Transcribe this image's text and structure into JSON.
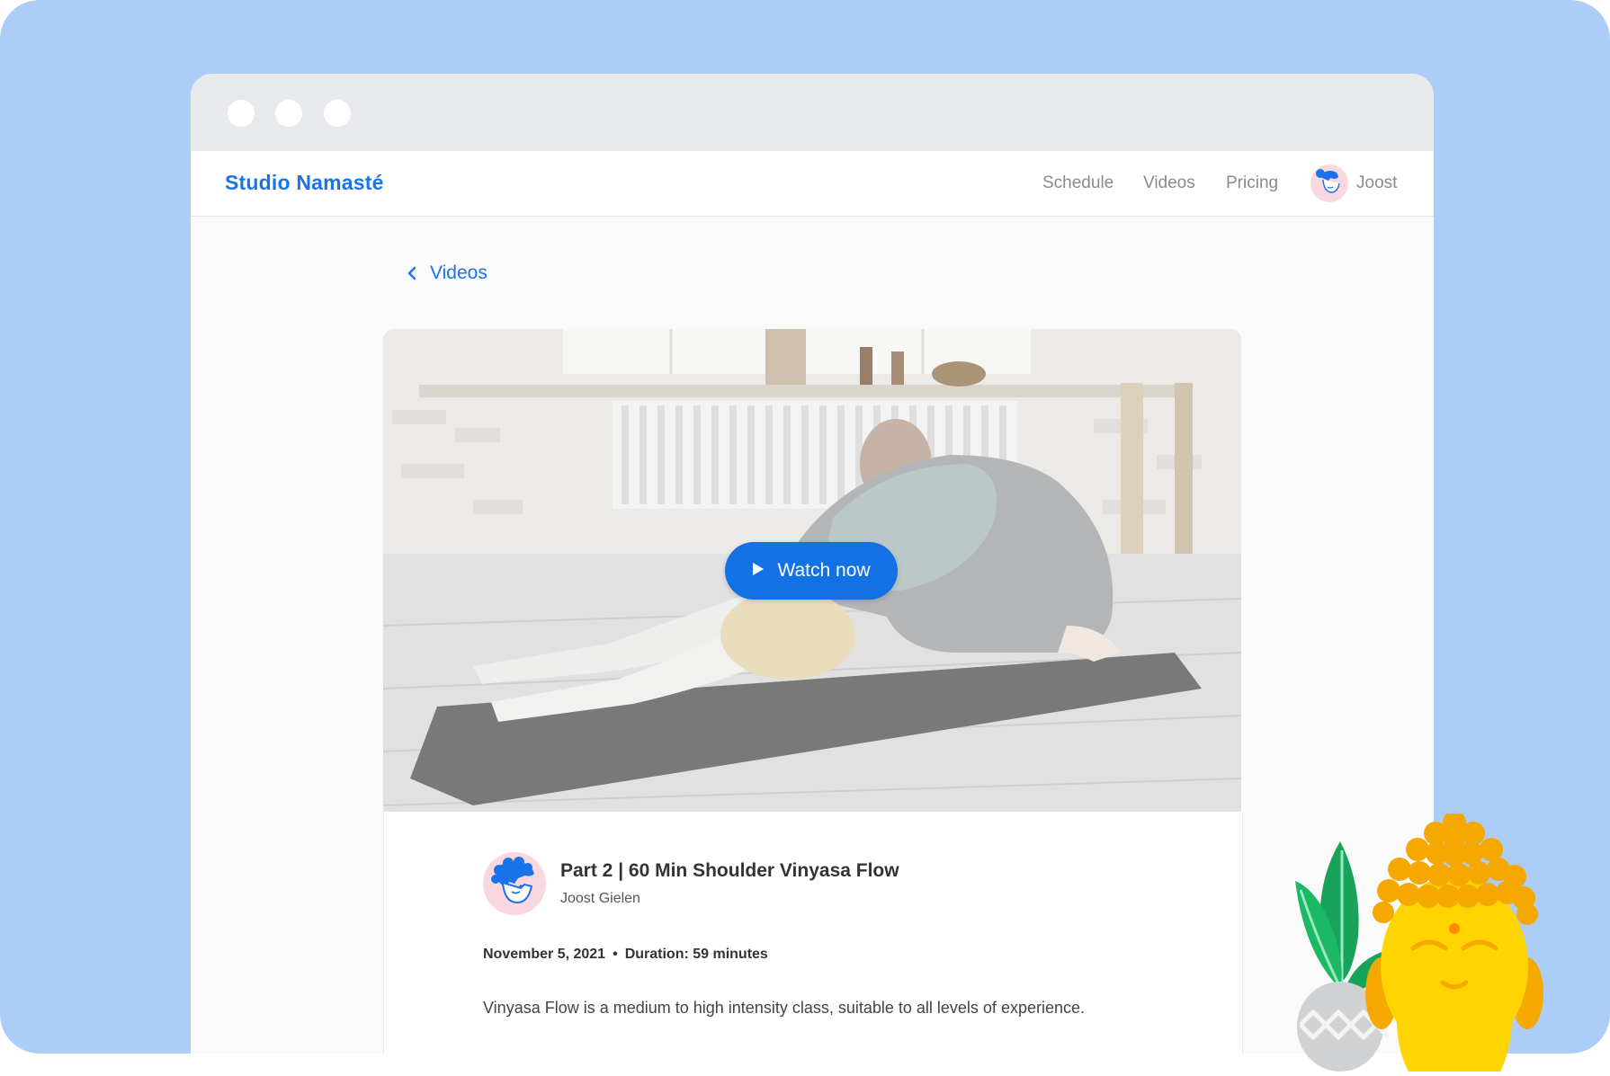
{
  "brand": {
    "name": "Studio Namasté",
    "color": "#1a73e8"
  },
  "nav": {
    "items": [
      {
        "label": "Schedule"
      },
      {
        "label": "Videos"
      },
      {
        "label": "Pricing"
      }
    ],
    "user": {
      "name": "Joost",
      "avatar_icon": "user-avatar-icon"
    }
  },
  "back": {
    "label": "Videos",
    "icon": "chevron-left-icon"
  },
  "video": {
    "watch_label": "Watch now",
    "play_icon": "play-icon",
    "title": "Part 2 | 60 Min Shoulder Vinyasa Flow",
    "author": "Joost Gielen",
    "date": "November 5, 2021",
    "separator": "•",
    "duration": "Duration: 59 minutes",
    "description": "Vinyasa Flow is a medium to high intensity class, suitable to all levels of experience."
  },
  "colors": {
    "background": "#abcdf8",
    "accent": "#1371e6",
    "titlebar": "#e8e9ec"
  }
}
